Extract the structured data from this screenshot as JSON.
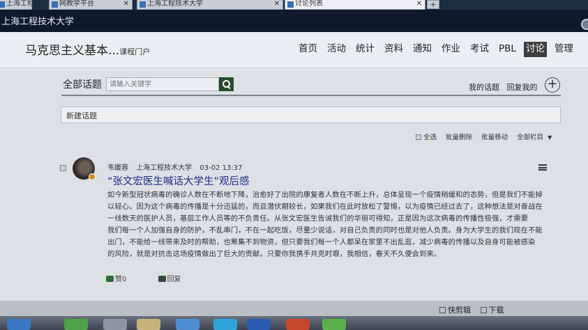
{
  "browser": {
    "tabs": [
      {
        "label": "上海工程技",
        "active": false
      },
      {
        "label": "网教学平台",
        "active": false
      },
      {
        "label": "上海工程技术大学",
        "active": false
      },
      {
        "label": "讨论列表",
        "active": true
      }
    ],
    "new_tab_label": "+"
  },
  "banner": {
    "school": "上海工程技术大学"
  },
  "header": {
    "course_title": "马克思主义基本...",
    "course_portal": "课程门户",
    "nav": [
      "首页",
      "活动",
      "统计",
      "资料",
      "通知",
      "作业",
      "考试",
      "PBL",
      "讨论",
      "管理"
    ],
    "active_nav": "讨论"
  },
  "discussion": {
    "heading": "全部话题",
    "search_placeholder": "请输入关键字",
    "my_topics": "我的话题",
    "my_replies": "回复我的",
    "add_symbol": "+",
    "new_topic": "新建话题",
    "toolbar": {
      "select_all": "全选",
      "batch_delete": "批量删除",
      "batch_move": "批量移动",
      "all_sections": "全部栏目"
    }
  },
  "post": {
    "author": "韦媛蓉",
    "school": "上海工程技术大学",
    "date": "03-02 13:37",
    "title": "“张文宏医生喊话大学生”观后感",
    "body_lines": [
      "如今新型冠状病毒的确诊人数在不断地下降，治愈好了出院的康复者人数在不断上升，总体呈现一个疫情稍缓和的态势，但是我们不能掉",
      "以轻心。因为这个病毒的传播是十分迅猛的，而且潜伏期较长，如果我们在此时放松了警惕，以为疫情已经过去了，这种想法是对奋战在",
      "一线数天的医护人员，基层工作人员等的不负责任。从张文宏医生告诫我们的华丽可得知，正是因为这次病毒的传播性极强，才需要",
      "我们每一个人加强自身的防护，不乱串门，不在一起吃饭，尽量少说话，对自己负责的同时也是对他人负责。身为大学生的我们现在不能",
      "出门，不能给一线带来及时的帮助，也筹集不到物资，但只要我们每一个人都呆在家里不出乱逛，减少病毒的传播以及自身可能被感染",
      "的风险，就是对抗击这场疫情做出了巨大的贡献。只要你我携手共克时艰，我相信，春天不久便会到来。"
    ],
    "likes": "赞0",
    "reply": "回复"
  },
  "bottom_bar": {
    "quick_clip": "快剪辑",
    "download": "下载"
  }
}
